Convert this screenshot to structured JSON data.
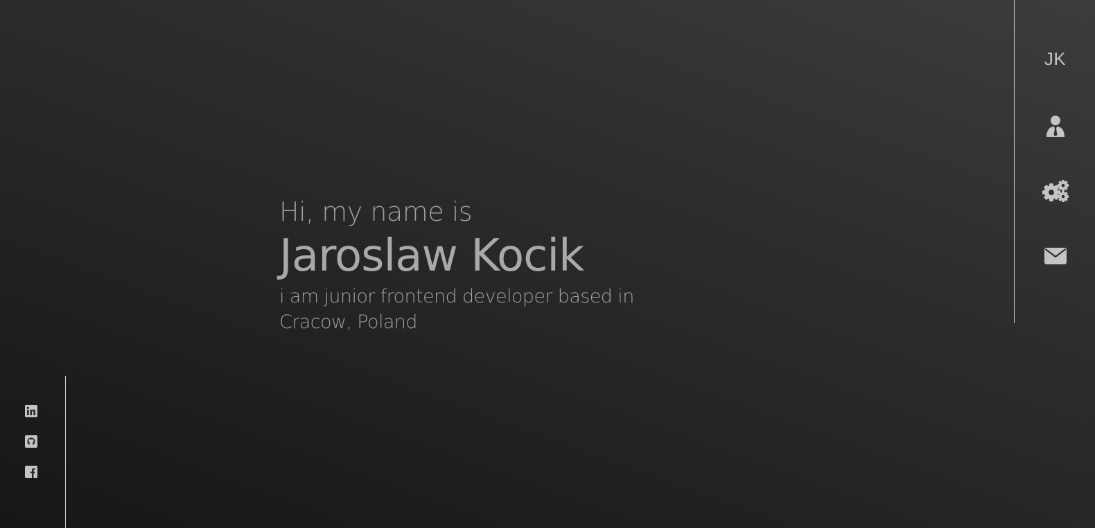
{
  "nav": {
    "logo": "JK",
    "items": [
      {
        "icon": "user-tie-icon"
      },
      {
        "icon": "cogs-icon"
      },
      {
        "icon": "envelope-icon"
      }
    ]
  },
  "hero": {
    "greeting": "Hi, my name is",
    "name": "Jaroslaw Kocik",
    "tagline": "i am junior frontend developer based in Cracow, Poland"
  },
  "social": [
    {
      "icon": "linkedin-icon"
    },
    {
      "icon": "github-icon"
    },
    {
      "icon": "facebook-icon"
    }
  ],
  "colors": {
    "background_top": "#3c3c3c",
    "background_bottom": "#161616",
    "text": "#a6a6a6",
    "line": "#cfcfcf"
  }
}
